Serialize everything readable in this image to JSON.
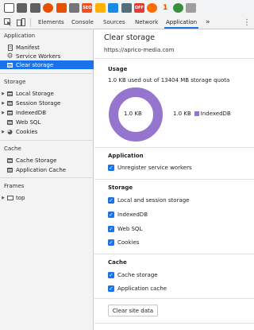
{
  "extensions": [
    {
      "icon": "extension-icon-1",
      "color": "#ffffff",
      "text": ""
    },
    {
      "icon": "extension-icon-2",
      "color": "#616161",
      "text": ""
    },
    {
      "icon": "extension-icon-3",
      "color": "#616161",
      "text": ""
    },
    {
      "icon": "extension-icon-4",
      "color": "#e65100",
      "text": ""
    },
    {
      "icon": "extension-icon-5",
      "color": "#e65100",
      "text": ""
    },
    {
      "icon": "extension-icon-6",
      "color": "#757575",
      "text": ""
    },
    {
      "icon": "extension-icon-7",
      "color": "#f4511e",
      "text": "SEO"
    },
    {
      "icon": "extension-icon-8",
      "color": "#ffb300",
      "text": ""
    },
    {
      "icon": "extension-icon-9",
      "color": "#1e88e5",
      "text": ""
    },
    {
      "icon": "extension-icon-10",
      "color": "#546e7a",
      "text": ""
    },
    {
      "icon": "extension-icon-11",
      "color": "#e53935",
      "text": "OFF"
    },
    {
      "icon": "extension-icon-12",
      "color": "#ff6d00",
      "text": ""
    },
    {
      "icon": "extension-icon-13",
      "color": "#ffffff",
      "text": "1"
    },
    {
      "icon": "extension-icon-14",
      "color": "#388e3c",
      "text": ""
    },
    {
      "icon": "extension-icon-15",
      "color": "#9e9e9e",
      "text": ""
    }
  ],
  "devtools": {
    "tabs": [
      "Elements",
      "Console",
      "Sources",
      "Network",
      "Application"
    ],
    "more": "»",
    "kebab": "⋮"
  },
  "sidebar": {
    "application_title": "Application",
    "application_items": [
      "Manifest",
      "Service Workers",
      "Clear storage"
    ],
    "storage_title": "Storage",
    "storage_items": [
      "Local Storage",
      "Session Storage",
      "IndexedDB",
      "Web SQL",
      "Cookies"
    ],
    "cache_title": "Cache",
    "cache_items": [
      "Cache Storage",
      "Application Cache"
    ],
    "frames_title": "Frames",
    "frames_items": [
      "top"
    ]
  },
  "main": {
    "title": "Clear storage",
    "origin": "https://aprico-media.com",
    "usage_title": "Usage",
    "usage_text": "1.0 KB used out of 13404 MB storage quota",
    "donut_label": "1.0 KB",
    "legend_value": "1.0 KB",
    "legend_name": "IndexedDB",
    "legend_color": "#9575cd",
    "application_title": "Application",
    "application_checks": [
      "Unregister service workers"
    ],
    "storage_title": "Storage",
    "storage_checks": [
      "Local and session storage",
      "IndexedDB",
      "Web SQL",
      "Cookies"
    ],
    "cache_title": "Cache",
    "cache_checks": [
      "Cache storage",
      "Application cache"
    ],
    "clear_button": "Clear site data"
  }
}
